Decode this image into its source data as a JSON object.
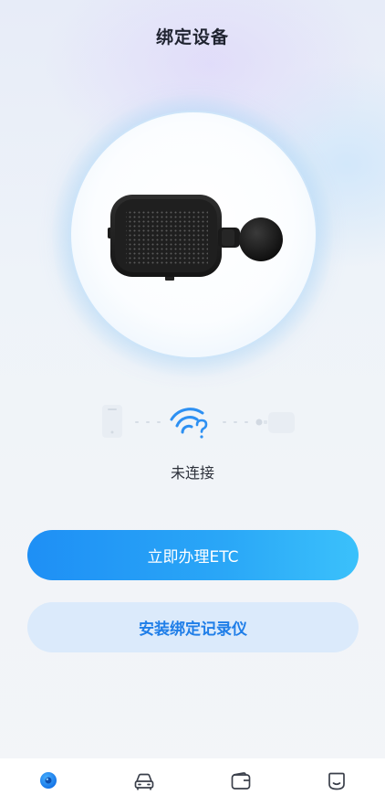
{
  "header": {
    "title": "绑定设备"
  },
  "device": {
    "image_icon": "dashcam-device",
    "connection_icons": [
      "phone-icon",
      "wifi-question-icon",
      "dashcam-mini-icon"
    ]
  },
  "status": {
    "text": "未连接"
  },
  "actions": {
    "primary_label": "立即办理ETC",
    "secondary_label": "安装绑定记录仪"
  },
  "tabbar": {
    "items": [
      {
        "icon": "camera-icon",
        "active": true
      },
      {
        "icon": "car-icon",
        "active": false
      },
      {
        "icon": "wallet-icon",
        "active": false
      },
      {
        "icon": "profile-icon",
        "active": false
      }
    ]
  },
  "colors": {
    "accent": "#1e8ff5",
    "accent_light": "#dbeafb",
    "accent_text": "#1f7ee8",
    "title_text": "#1f2330"
  }
}
